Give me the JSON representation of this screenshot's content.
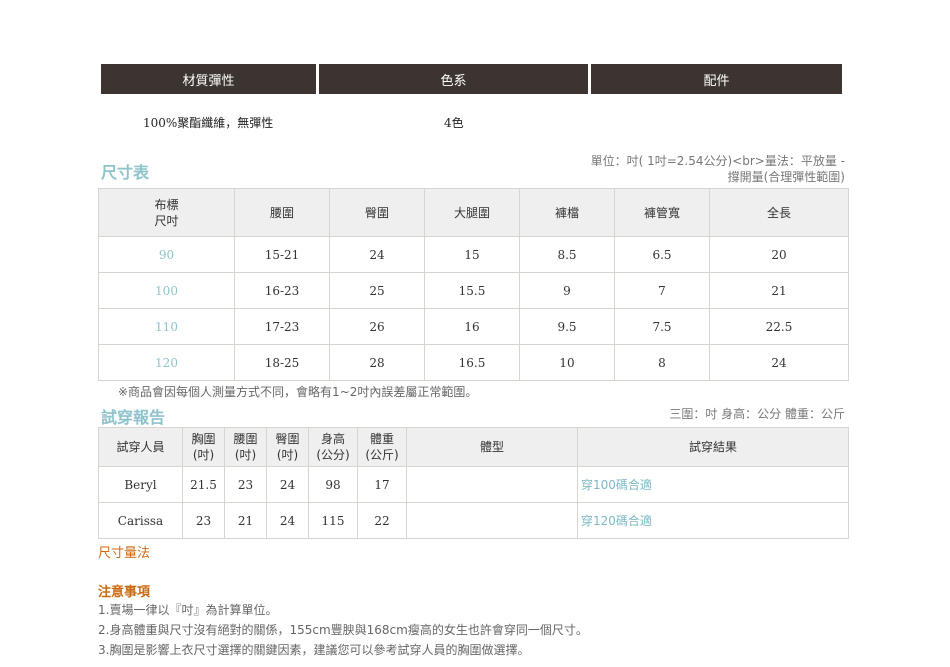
{
  "material": {
    "headers": [
      "材質彈性",
      "色系",
      "配件"
    ],
    "values": [
      "100%聚酯纖維，無彈性",
      "4色",
      ""
    ]
  },
  "size_chart": {
    "title": "尺寸表",
    "unit_note_line1": "單位：吋( 1吋=2.54公分)<br>量法：平放量 -",
    "unit_note_line2": "撐開量(合理彈性範圍)",
    "header_first_line1": "布標",
    "header_first_line2": "尺吋",
    "headers": [
      "腰圍",
      "臀圍",
      "大腿圍",
      "褲檔",
      "褲管寬",
      "全長"
    ],
    "rows": [
      {
        "size": "90",
        "values": [
          "15-21",
          "24",
          "15",
          "8.5",
          "6.5",
          "20"
        ]
      },
      {
        "size": "100",
        "values": [
          "16-23",
          "25",
          "15.5",
          "9",
          "7",
          "21"
        ]
      },
      {
        "size": "110",
        "values": [
          "17-23",
          "26",
          "16",
          "9.5",
          "7.5",
          "22.5"
        ]
      },
      {
        "size": "120",
        "values": [
          "18-25",
          "28",
          "16.5",
          "10",
          "8",
          "24"
        ]
      }
    ],
    "disclaimer": "※商品會因每個人測量方式不同，會略有1~2吋內誤差屬正常範圍。"
  },
  "fit_report": {
    "title": "試穿報告",
    "unit_note": "三圍：吋 身高：公分 體重：公斤",
    "headers": {
      "person": "試穿人員",
      "chest": [
        "胸圍",
        "(吋)"
      ],
      "waist": [
        "腰圍",
        "(吋)"
      ],
      "hip": [
        "臀圍",
        "(吋)"
      ],
      "height": [
        "身高",
        "(公分)"
      ],
      "weight": [
        "體重",
        "(公斤)"
      ],
      "body_type": "體型",
      "result": "試穿結果"
    },
    "rows": [
      {
        "name": "Beryl",
        "chest": "21.5",
        "waist": "23",
        "hip": "24",
        "height": "98",
        "weight": "17",
        "body_type": "",
        "result": "穿100碼合適"
      },
      {
        "name": "Carissa",
        "chest": "23",
        "waist": "21",
        "hip": "24",
        "height": "115",
        "weight": "22",
        "body_type": "",
        "result": "穿120碼合適"
      }
    ]
  },
  "measure_link": "尺寸量法",
  "notes": {
    "title": "注意事項",
    "items": [
      "1.賣場一律以『吋』為計算單位。",
      "2.身高體重與尺寸沒有絕對的關係，155cm豐腴與168cm瘦高的女生也許會穿同一個尺寸。",
      "3.胸圍是影響上衣尺寸選擇的關鍵因素，建議您可以參考試穿人員的胸圍做選擇。"
    ]
  },
  "colors": {
    "header_bar": "#3b3430",
    "accent_teal": "#8ec3cc",
    "accent_orange": "#cc6a13"
  }
}
